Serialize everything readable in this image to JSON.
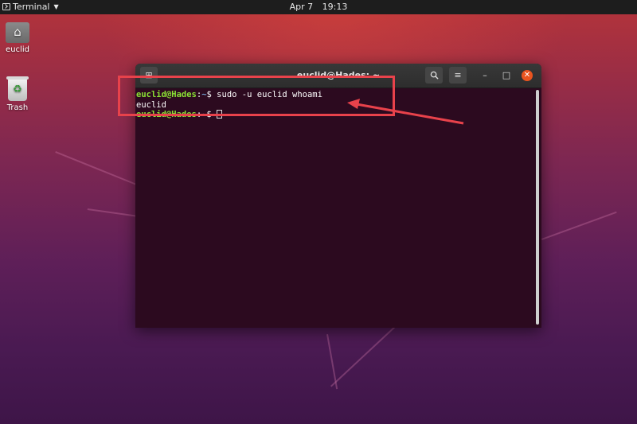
{
  "topbar": {
    "app_menu": "Terminal",
    "date": "Apr 7",
    "time": "19:13"
  },
  "desktop": {
    "icons": [
      {
        "label": "euclid",
        "icon": "home-folder-icon"
      },
      {
        "label": "Trash",
        "icon": "trash-icon"
      }
    ]
  },
  "terminal": {
    "title": "euclid@Hades: ~",
    "lines": [
      {
        "user": "euclid@Hades",
        "sep": ":",
        "path": "~",
        "prompt": "$ ",
        "text": "sudo -u euclid whoami"
      },
      {
        "text": "euclid"
      },
      {
        "user": "euclid@Hades",
        "sep": ":",
        "path": "~",
        "prompt": "$ ",
        "text": ""
      }
    ]
  },
  "annotation": {
    "color": "#e8424b"
  },
  "colors": {
    "prompt_user": "#8ae234",
    "prompt_path": "#729fcf",
    "terminal_bg": "#2c0a1f",
    "close_button": "#e9541f"
  }
}
